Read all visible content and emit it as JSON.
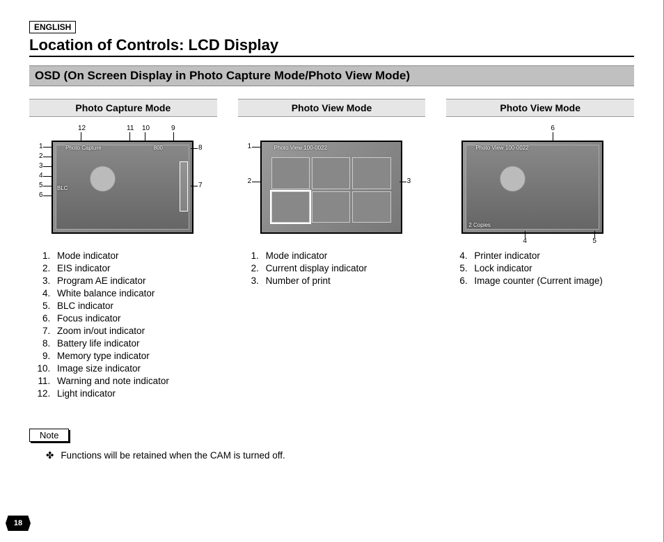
{
  "language_tag": "ENGLISH",
  "title": "Location of Controls: LCD Display",
  "subtitle": "OSD (On Screen Display in Photo Capture Mode/Photo View Mode)",
  "columns": {
    "col1": {
      "header": "Photo Capture Mode",
      "osd_label": "Photo Capture",
      "osd_size": "800",
      "osd_blc": "BLC",
      "callouts_left": [
        "1",
        "2",
        "3",
        "4",
        "5",
        "6"
      ],
      "callouts_right": [
        "8",
        "7"
      ],
      "callouts_top": [
        "12",
        "11",
        "10",
        "9"
      ],
      "legend": [
        "Mode indicator",
        "EIS indicator",
        "Program AE indicator",
        "White balance indicator",
        "BLC indicator",
        "Focus indicator",
        "Zoom in/out indicator",
        "Battery life indicator",
        "Memory type indicator",
        "Image size indicator",
        "Warning and note indicator",
        "Light indicator"
      ]
    },
    "col2": {
      "header": "Photo View Mode",
      "osd_label": "Photo View  100-0022",
      "callouts_left": [
        "1",
        "2"
      ],
      "callouts_right": [
        "3"
      ],
      "legend": [
        "Mode indicator",
        "Current display indicator",
        "Number of print"
      ]
    },
    "col3": {
      "header": "Photo View Mode",
      "osd_label": "Photo View  100-0022",
      "osd_copies": "2 Copies",
      "callouts_top": [
        "6"
      ],
      "callouts_bottom": [
        "4",
        "5"
      ],
      "legend_start": 4,
      "legend": [
        "Printer indicator",
        "Lock indicator",
        "Image counter (Current image)"
      ]
    }
  },
  "note_label": "Note",
  "note_text": "Functions will be retained when the CAM is turned off.",
  "page_number": "18"
}
